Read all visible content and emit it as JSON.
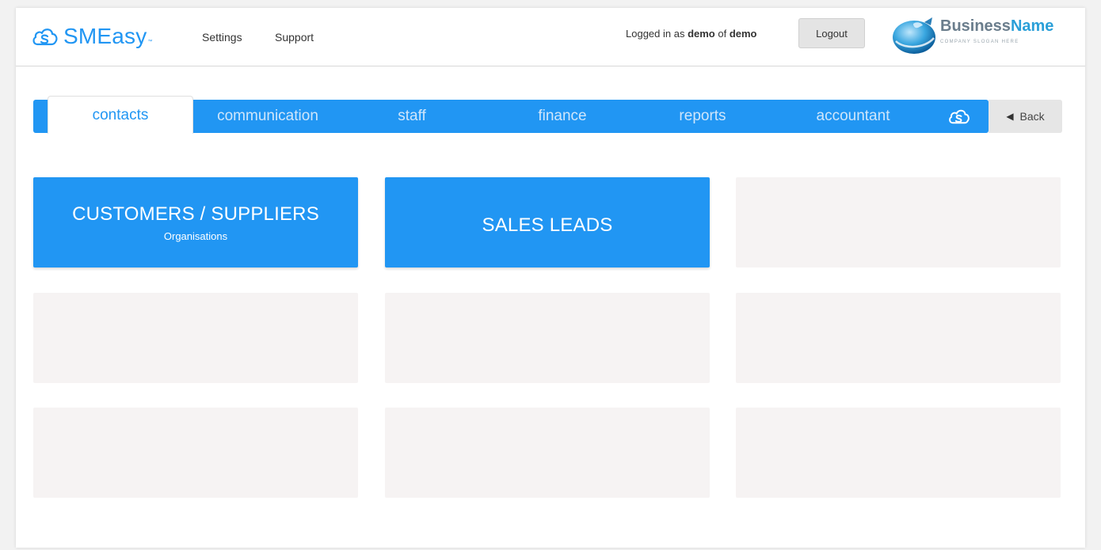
{
  "header": {
    "logo_text": "SMEasy",
    "logo_tm": "™",
    "links": [
      "Settings",
      "Support"
    ],
    "logged_in_prefix": "Logged in as ",
    "user": "demo",
    "logged_in_mid": " of ",
    "org": "demo",
    "logout_label": "Logout",
    "business_name_part1": "Business",
    "business_name_part2": "Name",
    "company_slogan": "COMPANY SLOGAN HERE"
  },
  "nav": {
    "tabs": [
      "contacts",
      "communication",
      "staff",
      "finance",
      "reports",
      "accountant"
    ],
    "active": "contacts",
    "back_label": "Back"
  },
  "tiles": [
    {
      "title": "CUSTOMERS / SUPPLIERS",
      "subtitle": "Organisations"
    },
    {
      "title": "SALES LEADS",
      "subtitle": ""
    }
  ],
  "colors": {
    "accent": "#2196f3",
    "empty_tile": "#f6f3f3",
    "back_button": "#e6e6e6"
  }
}
